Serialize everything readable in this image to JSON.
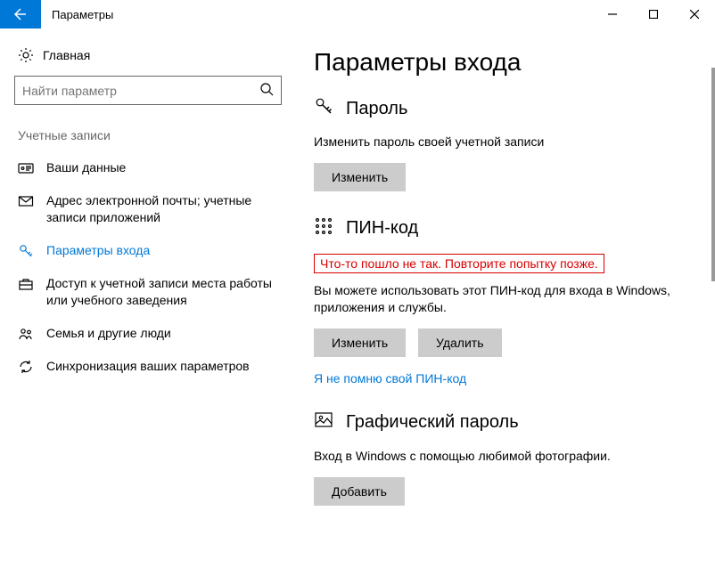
{
  "titlebar": {
    "title": "Параметры"
  },
  "sidebar": {
    "home": "Главная",
    "search_placeholder": "Найти параметр",
    "section": "Учетные записи",
    "items": [
      {
        "label": "Ваши данные"
      },
      {
        "label": "Адрес электронной почты; учетные записи приложений"
      },
      {
        "label": "Параметры входа"
      },
      {
        "label": "Доступ к учетной записи места работы или учебного заведения"
      },
      {
        "label": "Семья и другие люди"
      },
      {
        "label": "Синхронизация ваших параметров"
      }
    ]
  },
  "main": {
    "heading": "Параметры входа",
    "password": {
      "title": "Пароль",
      "desc": "Изменить пароль своей учетной записи",
      "change": "Изменить"
    },
    "pin": {
      "title": "ПИН-код",
      "error": "Что-то пошло не так. Повторите попытку позже.",
      "desc": "Вы можете использовать этот ПИН-код для входа в Windows, приложения и службы.",
      "change": "Изменить",
      "delete": "Удалить",
      "forgot": "Я не помню свой ПИН-код"
    },
    "picture": {
      "title": "Графический пароль",
      "desc": "Вход в Windows с помощью любимой фотографии.",
      "add": "Добавить"
    }
  }
}
